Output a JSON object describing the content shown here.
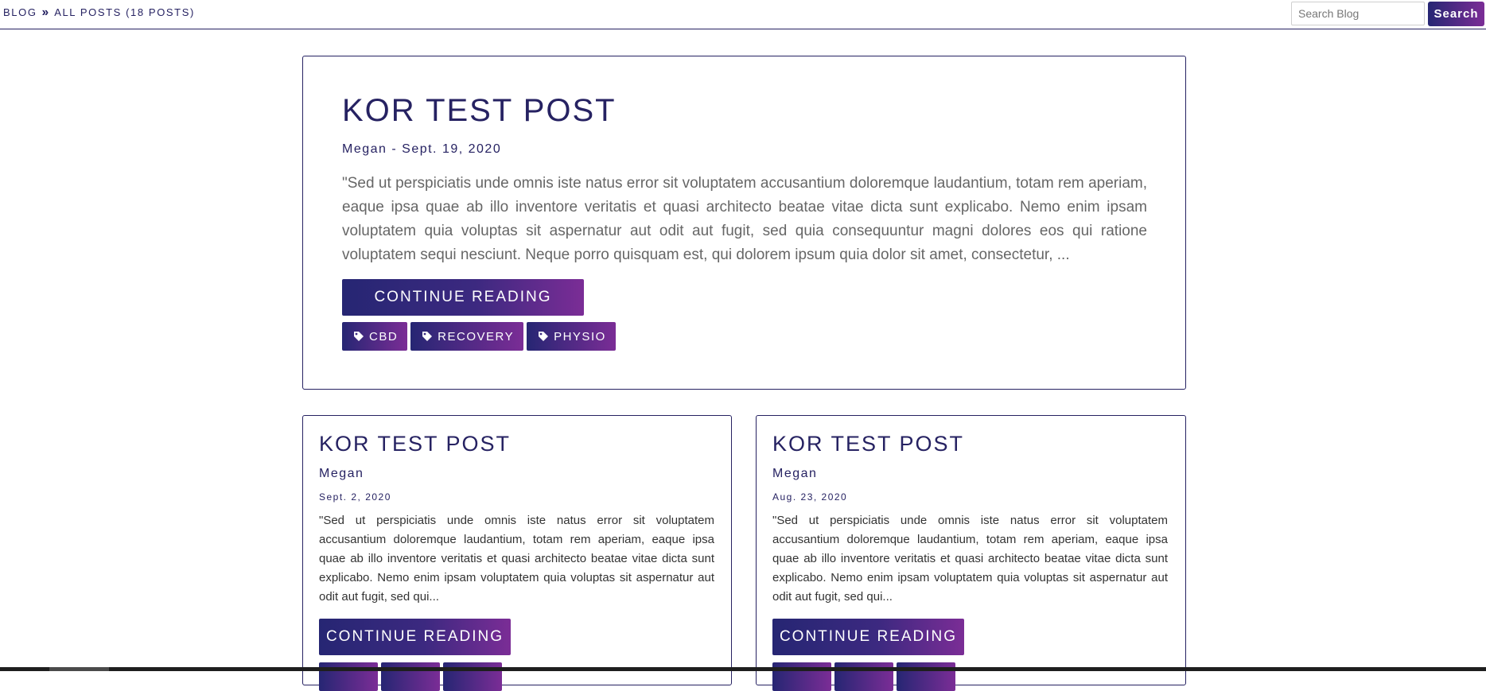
{
  "breadcrumb": {
    "root": "BLOG",
    "current": "ALL POSTS (18 POSTS)"
  },
  "search": {
    "placeholder": "Search Blog",
    "button_label": "Search"
  },
  "featured_post": {
    "title": "KOR TEST POST",
    "meta": "Megan - Sept. 19, 2020",
    "excerpt": "\"Sed ut perspiciatis unde omnis iste natus error sit voluptatem accusantium doloremque laudantium, totam rem aperiam, eaque ipsa quae ab illo inventore veritatis et quasi architecto beatae vitae dicta sunt explicabo. Nemo enim ipsam voluptatem quia voluptas sit aspernatur aut odit aut fugit, sed quia consequuntur magni dolores eos qui ratione voluptatem sequi nesciunt. Neque porro quisquam est, qui dolorem ipsum quia dolor sit amet, consectetur, ...",
    "button_label": "CONTINUE READING",
    "tags": [
      "CBD",
      "RECOVERY",
      "PHYSIO"
    ]
  },
  "posts": [
    {
      "title": "KOR TEST POST",
      "author": "Megan",
      "date": "Sept. 2, 2020",
      "excerpt": "\"Sed ut perspiciatis unde omnis iste natus error sit voluptatem accusantium doloremque laudantium, totam rem aperiam, eaque ipsa quae ab illo inventore veritatis et quasi architecto beatae vitae dicta sunt explicabo. Nemo enim ipsam voluptatem quia voluptas sit aspernatur aut odit aut fugit, sed qui...",
      "button_label": "CONTINUE READING"
    },
    {
      "title": "KOR TEST POST",
      "author": "Megan",
      "date": "Aug. 23, 2020",
      "excerpt": "\"Sed ut perspiciatis unde omnis iste natus error sit voluptatem accusantium doloremque laudantium, totam rem aperiam, eaque ipsa quae ab illo inventore veritatis et quasi architecto beatae vitae dicta sunt explicabo. Nemo enim ipsam voluptatem quia voluptas sit aspernatur aut odit aut fugit, sed qui...",
      "button_label": "CONTINUE READING"
    }
  ],
  "icons": {
    "breadcrumb_separator": "double-chevron-right-icon",
    "tag": "tag-icon"
  },
  "colors": {
    "primary": "#262262",
    "gradient_start": "#262673",
    "gradient_end": "#7b2d96",
    "excerpt_text": "#666666"
  }
}
